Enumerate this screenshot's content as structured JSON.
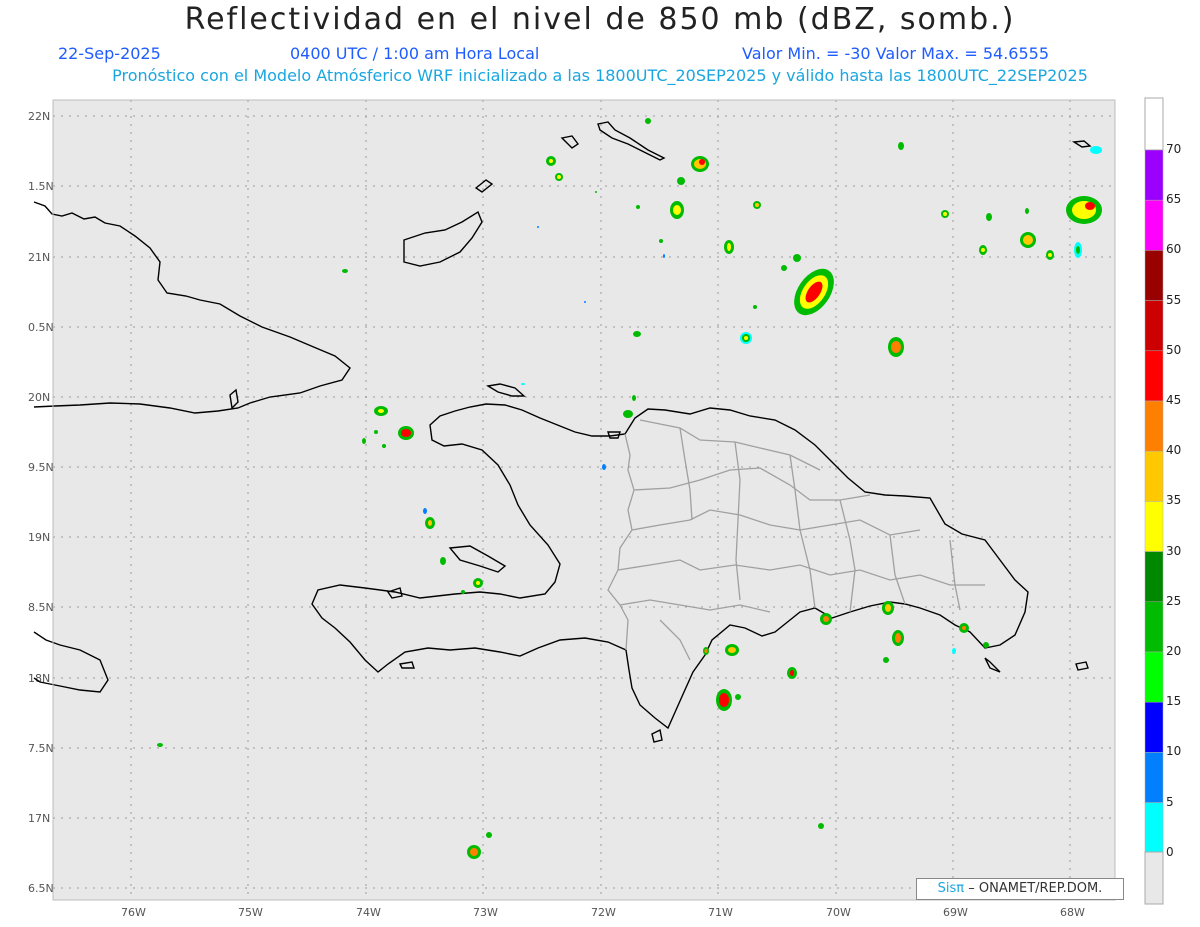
{
  "header": {
    "title": "Reflectividad en el nivel de 850 mb (dBZ, somb.)",
    "date": "22-Sep-2025",
    "time": "0400 UTC / 1:00 am Hora Local",
    "minmax": "Valor Min. = -30  Valor Max. = 54.6555",
    "forecast": "Pronóstico con el Modelo Atmósferico WRF inicializado a las 1800UTC_20SEP2025 y válido hasta las  1800UTC_22SEP2025"
  },
  "axes": {
    "lat_labels": [
      "22N",
      "1.5N",
      "21N",
      "0.5N",
      "20N",
      "9.5N",
      "19N",
      "8.5N",
      "18N",
      "7.5N",
      "17N",
      "6.5N"
    ],
    "lon_labels": [
      "76W",
      "75W",
      "74W",
      "73W",
      "72W",
      "71W",
      "70W",
      "69W",
      "68W"
    ]
  },
  "colorbar": {
    "labels": [
      "70",
      "65",
      "60",
      "55",
      "50",
      "45",
      "40",
      "35",
      "30",
      "25",
      "20",
      "15",
      "10",
      "5",
      "0"
    ],
    "colors": [
      "#9b00ff",
      "#ff00ff",
      "#990000",
      "#cc0000",
      "#ff0000",
      "#ff7f00",
      "#ffc800",
      "#ffff00",
      "#008800",
      "#00bb00",
      "#00ff00",
      "#0000ff",
      "#0080ff",
      "#00ffff",
      "#e8e8e8"
    ]
  },
  "credit": {
    "sis": "Sisπ",
    "text": "– ONAMET/REP.DOM."
  },
  "map": {
    "background": "#e8e8e8",
    "coast_color": "#000000",
    "border_color": "#a0a0a0"
  }
}
